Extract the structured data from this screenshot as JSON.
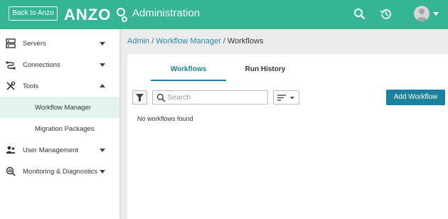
{
  "topbar": {
    "back_label": "Back to Anzo",
    "logo_text": "ANZO",
    "title": "Administration",
    "icons": [
      "search-icon",
      "history-icon",
      "user-avatar-icon",
      "chevron-down-icon"
    ],
    "color": "#35b594"
  },
  "sidebar": {
    "items": [
      {
        "label": "Servers",
        "icon": "server-icon",
        "expanded": false
      },
      {
        "label": "Connections",
        "icon": "connection-icon",
        "expanded": false
      },
      {
        "label": "Tools",
        "icon": "tools-icon",
        "expanded": true
      },
      {
        "label": "User Management",
        "icon": "users-icon",
        "expanded": false
      },
      {
        "label": "Monitoring & Diagnostics",
        "icon": "monitoring-icon",
        "expanded": false
      }
    ],
    "sub_items": [
      {
        "label": "Workflow Manager",
        "active": true
      },
      {
        "label": "Migration Packages",
        "active": false
      }
    ],
    "active_color": "#e3f4ee"
  },
  "breadcrumb": {
    "items": [
      "Admin",
      "Workflow Manager",
      "Workflows"
    ]
  },
  "main": {
    "tabs": [
      {
        "label": "Workflows",
        "active": true
      },
      {
        "label": "Run History",
        "active": false
      }
    ],
    "search": {
      "placeholder": "Search",
      "value": ""
    },
    "add_button_label": "Add Workflow",
    "empty_message": "No workflows found",
    "accent_color": "#1a829e"
  }
}
